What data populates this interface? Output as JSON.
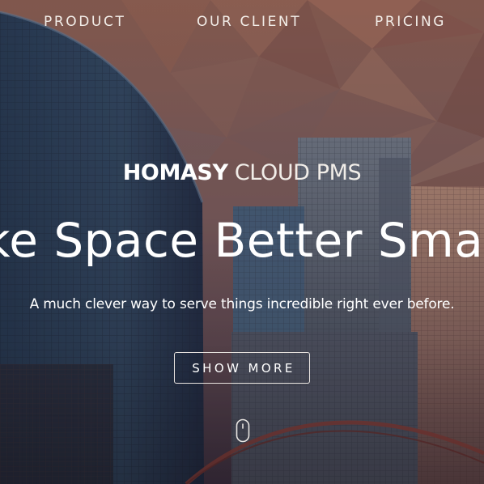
{
  "nav": {
    "items": [
      {
        "label": "PRODUCT"
      },
      {
        "label": "OUR CLIENT"
      },
      {
        "label": "PRICING"
      }
    ]
  },
  "hero": {
    "brand_strong": "HOMASY",
    "brand_light": "CLOUD PMS",
    "headline": "Make Space Better Smarter",
    "tagline": "A much clever way to serve things incredible right ever before.",
    "cta_label": "SHOW MORE",
    "scroll_icon": "mouse-scroll-icon"
  },
  "colors": {
    "overlay_warm": "#b06a4e",
    "overlay_cool": "#2c3a5c",
    "text": "#ffffff"
  }
}
